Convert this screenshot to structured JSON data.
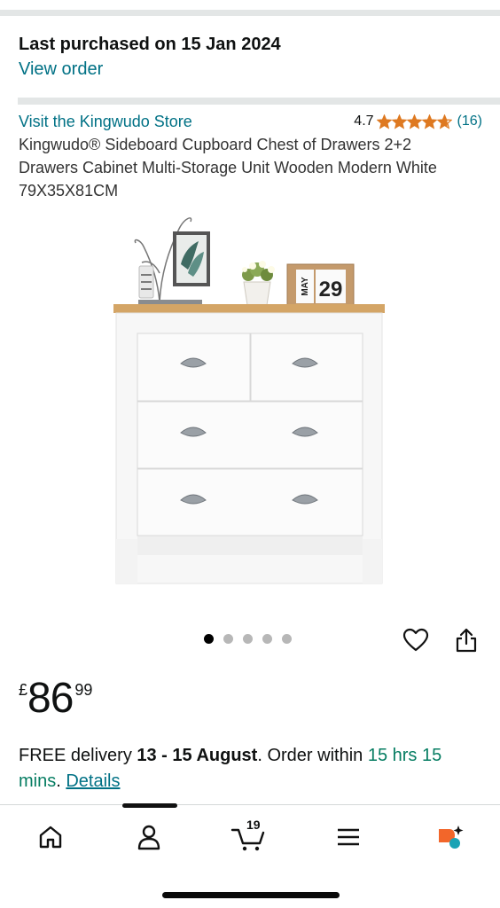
{
  "purchase": {
    "title": "Last purchased on 15 Jan 2024",
    "view_order_label": "View order"
  },
  "product": {
    "store_link": "Visit the Kingwudo Store",
    "rating_value": "4.7",
    "rating_stars": 4.7,
    "rating_count": "(16)",
    "title": "Kingwudo® Sideboard Cupboard Chest of Drawers 2+2 Drawers Cabinet Multi-Storage Unit Wooden Modern White 79X35X81CM",
    "calendar_month": "MAY",
    "calendar_day": "29"
  },
  "gallery": {
    "image_count": 5,
    "active_index": 0
  },
  "price": {
    "currency": "£",
    "whole": "86",
    "fraction": "99"
  },
  "delivery": {
    "prefix": "FREE delivery ",
    "date": "13 - 15 August",
    "middle": ". Order within ",
    "countdown": "15 hrs 15 mins",
    "suffix": ". ",
    "details_label": "Details"
  },
  "nav": {
    "cart_count": "19"
  },
  "colors": {
    "link": "#007185",
    "star": "#de7921",
    "green": "#067d62",
    "rufus_orange": "#f2662a",
    "rufus_teal": "#1aa3b5"
  }
}
